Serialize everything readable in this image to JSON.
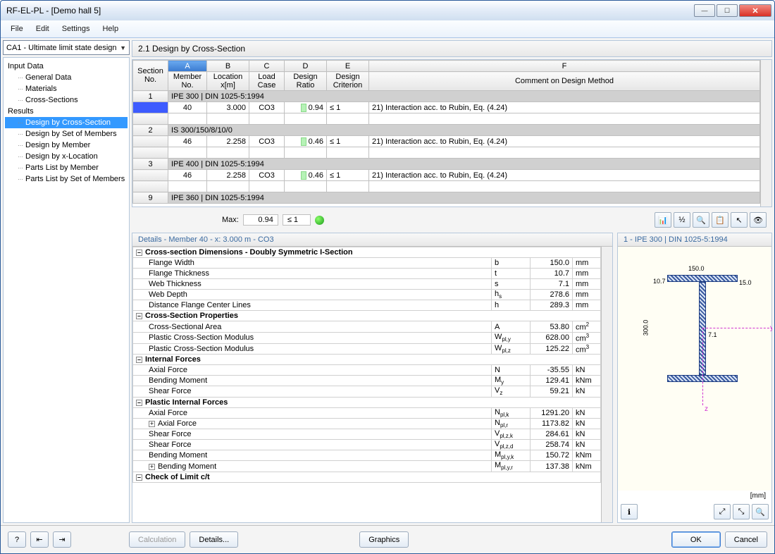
{
  "window": {
    "title": "RF-EL-PL - [Demo hall 5]"
  },
  "menu": {
    "file": "File",
    "edit": "Edit",
    "settings": "Settings",
    "help": "Help"
  },
  "combo": {
    "value": "CA1 - Ultimate limit state design"
  },
  "tree": {
    "inputData": "Input Data",
    "generalData": "General Data",
    "materials": "Materials",
    "crossSections": "Cross-Sections",
    "results": "Results",
    "byCrossSection": "Design by Cross-Section",
    "bySetMembers": "Design by Set of Members",
    "byMember": "Design by Member",
    "byXLocation": "Design by x-Location",
    "partsMember": "Parts List by Member",
    "partsSet": "Parts List by Set of Members"
  },
  "panelTitle": "2.1 Design by Cross-Section",
  "gridCols": {
    "A": "A",
    "B": "B",
    "C": "C",
    "D": "D",
    "E": "E",
    "F": "F",
    "sectionNo": "Section No.",
    "memberNo": "Member No.",
    "location": "Location x[m]",
    "loadCase": "Load Case",
    "designRatio": "Design Ratio",
    "designCriterion": "Design Criterion",
    "comment": "Comment on Design Method"
  },
  "sections": [
    {
      "no": "1",
      "name": "IPE 300 | DIN 1025-5:1994",
      "member": "40",
      "x": "3.000",
      "lc": "CO3",
      "ratio": "0.94",
      "crit": "≤ 1",
      "comment": "21) Interaction acc. to Rubin, Eq. (4.24)"
    },
    {
      "no": "2",
      "name": "IS 300/150/8/10/0",
      "member": "46",
      "x": "2.258",
      "lc": "CO3",
      "ratio": "0.46",
      "crit": "≤ 1",
      "comment": "21) Interaction acc. to Rubin, Eq. (4.24)"
    },
    {
      "no": "3",
      "name": "IPE 400 | DIN 1025-5:1994",
      "member": "46",
      "x": "2.258",
      "lc": "CO3",
      "ratio": "0.46",
      "crit": "≤ 1",
      "comment": "21) Interaction acc. to Rubin, Eq. (4.24)"
    },
    {
      "no": "9",
      "name": "IPE 360 | DIN 1025-5:1994"
    }
  ],
  "max": {
    "label": "Max:",
    "value": "0.94",
    "crit": "≤ 1"
  },
  "detailsTitle": "Details - Member 40 - x: 3.000 m - CO3",
  "details": {
    "dimHeader": "Cross-section Dimensions - Doubly Symmetric I-Section",
    "rows1": [
      {
        "label": "Flange Width",
        "sym": "b",
        "val": "150.0",
        "unit": "mm"
      },
      {
        "label": "Flange Thickness",
        "sym": "t",
        "val": "10.7",
        "unit": "mm"
      },
      {
        "label": "Web Thickness",
        "sym": "s",
        "val": "7.1",
        "unit": "mm"
      },
      {
        "label": "Web Depth",
        "sym": "h<sub>s</sub>",
        "val": "278.6",
        "unit": "mm"
      },
      {
        "label": "Distance Flange Center Lines",
        "sym": "h",
        "val": "289.3",
        "unit": "mm"
      }
    ],
    "propHeader": "Cross-Section Properties",
    "rows2": [
      {
        "label": "Cross-Sectional Area",
        "sym": "A",
        "val": "53.80",
        "unit": "cm<sup>2</sup>"
      },
      {
        "label": "Plastic Cross-Section Modulus",
        "sym": "W<sub>pl,y</sub>",
        "val": "628.00",
        "unit": "cm<sup>3</sup>"
      },
      {
        "label": "Plastic Cross-Section Modulus",
        "sym": "W<sub>pl,z</sub>",
        "val": "125.22",
        "unit": "cm<sup>3</sup>"
      }
    ],
    "forcesHeader": "Internal Forces",
    "rows3": [
      {
        "label": "Axial Force",
        "sym": "N",
        "val": "-35.55",
        "unit": "kN"
      },
      {
        "label": "Bending Moment",
        "sym": "M<sub>y</sub>",
        "val": "129.41",
        "unit": "kNm"
      },
      {
        "label": "Shear Force",
        "sym": "V<sub>z</sub>",
        "val": "59.21",
        "unit": "kN"
      }
    ],
    "plasticHeader": "Plastic Internal Forces",
    "rows4": [
      {
        "label": "Axial Force",
        "sym": "N<sub>pl,k</sub>",
        "val": "1291.20",
        "unit": "kN"
      },
      {
        "label": "Axial Force",
        "sym": "N<sub>pl,r</sub>",
        "val": "1173.82",
        "unit": "kN",
        "pm": "+"
      },
      {
        "label": "Shear Force",
        "sym": "V<sub>pl,z,k</sub>",
        "val": "284.61",
        "unit": "kN"
      },
      {
        "label": "Shear Force",
        "sym": "V<sub>pl,z,d</sub>",
        "val": "258.74",
        "unit": "kN"
      },
      {
        "label": "Bending Moment",
        "sym": "M<sub>pl,y,k</sub>",
        "val": "150.72",
        "unit": "kNm"
      },
      {
        "label": "Bending Moment",
        "sym": "M<sub>pl,y,r</sub>",
        "val": "137.38",
        "unit": "kNm",
        "pm": "+"
      }
    ],
    "checkHeader": "Check of Limit c/t"
  },
  "preview": {
    "title": "1 - IPE 300 | DIN 1025-5:1994",
    "w": "150.0",
    "t": "10.7",
    "s": "7.1",
    "h": "300.0",
    "off": "15.0",
    "axisY": "y",
    "axisZ": "z",
    "unit": "[mm]"
  },
  "buttons": {
    "calculation": "Calculation",
    "details": "Details...",
    "graphics": "Graphics",
    "ok": "OK",
    "cancel": "Cancel"
  }
}
